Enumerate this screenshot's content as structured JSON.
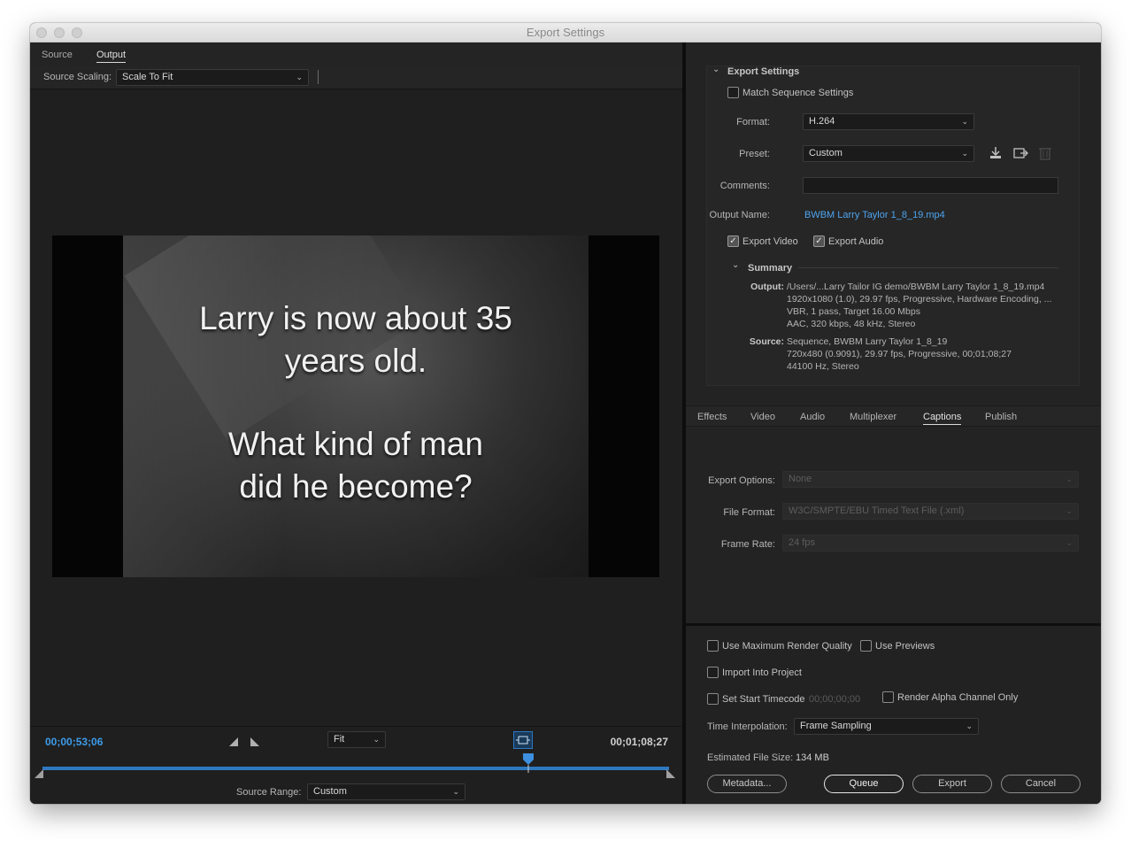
{
  "window": {
    "title": "Export Settings"
  },
  "left": {
    "tabs": [
      {
        "label": "Source"
      },
      {
        "label": "Output"
      }
    ],
    "source_scaling": {
      "label": "Source Scaling:",
      "value": "Scale To Fit"
    },
    "video_text": [
      "Larry is now about 35",
      "years old.",
      "What kind of man",
      "did he become?"
    ],
    "timeline": {
      "current": "00;00;53;06",
      "end": "00;01;08;27",
      "zoom": "Fit",
      "playhead_fraction": 0.775,
      "source_range_label": "Source Range:",
      "source_range_value": "Custom"
    }
  },
  "export_settings": {
    "title": "Export Settings",
    "match_sequence_label": "Match Sequence Settings",
    "format_label": "Format:",
    "format_value": "H.264",
    "preset_label": "Preset:",
    "preset_value": "Custom",
    "comments_label": "Comments:",
    "output_name_label": "Output Name:",
    "output_name_value": "BWBM Larry Taylor 1_8_19.mp4",
    "export_video_label": "Export Video",
    "export_audio_label": "Export Audio",
    "summary": {
      "title": "Summary",
      "output_label": "Output:",
      "output_lines": [
        "/Users/...Larry Tailor IG demo/BWBM Larry Taylor 1_8_19.mp4",
        "1920x1080 (1.0), 29.97 fps, Progressive, Hardware Encoding, ...",
        "VBR, 1 pass, Target 16.00 Mbps",
        "AAC, 320 kbps, 48 kHz, Stereo"
      ],
      "source_label": "Source:",
      "source_lines": [
        "Sequence, BWBM Larry Taylor 1_8_19",
        "720x480 (0.9091), 29.97 fps, Progressive, 00;01;08;27",
        "44100 Hz, Stereo"
      ]
    }
  },
  "settings_tabs": [
    {
      "label": "Effects"
    },
    {
      "label": "Video"
    },
    {
      "label": "Audio"
    },
    {
      "label": "Multiplexer"
    },
    {
      "label": "Captions"
    },
    {
      "label": "Publish"
    }
  ],
  "captions": {
    "export_options_label": "Export Options:",
    "export_options_value": "None",
    "file_format_label": "File Format:",
    "file_format_value": "W3C/SMPTE/EBU Timed Text File (.xml)",
    "frame_rate_label": "Frame Rate:",
    "frame_rate_value": "24 fps"
  },
  "bottom": {
    "max_render_label": "Use Maximum Render Quality",
    "use_previews_label": "Use Previews",
    "import_project_label": "Import Into Project",
    "start_timecode_label": "Set Start Timecode",
    "start_timecode_value": "00;00;00;00",
    "render_alpha_label": "Render Alpha Channel Only",
    "time_interp_label": "Time Interpolation:",
    "time_interp_value": "Frame Sampling",
    "file_size_label": "Estimated File Size:",
    "file_size_value": "134 MB",
    "buttons": {
      "metadata": "Metadata...",
      "queue": "Queue",
      "export": "Export",
      "cancel": "Cancel"
    }
  }
}
